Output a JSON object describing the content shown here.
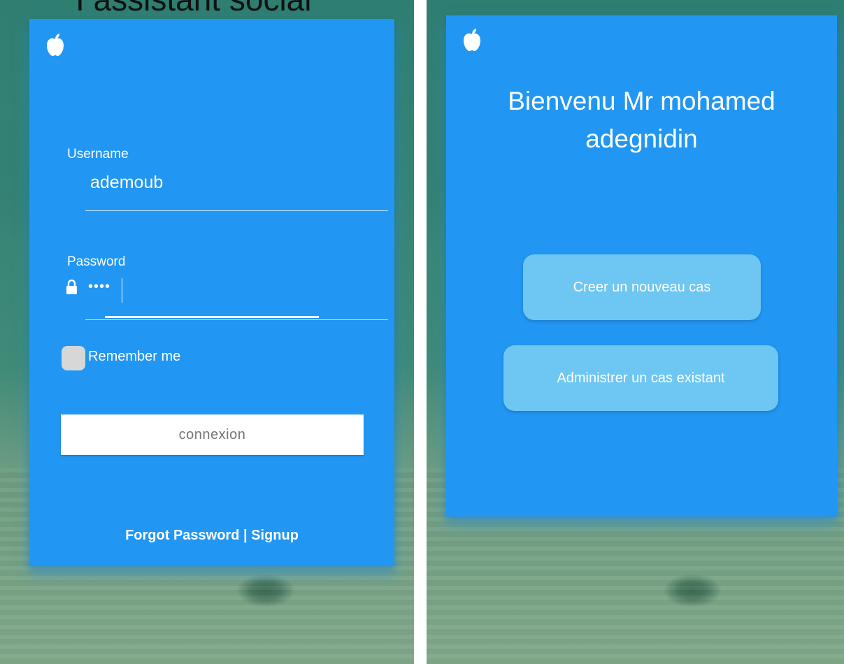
{
  "left_screen": {
    "overlay_text": "I assistant social",
    "login": {
      "username_label": "Username",
      "username_value": "ademoub",
      "password_label": "Password",
      "password_value": "••••",
      "remember_label": "Remember me",
      "connect_label": "connexion",
      "forgot_label": "Forgot Password",
      "separator": " | ",
      "signup_label": "Signup"
    }
  },
  "right_screen": {
    "welcome": {
      "title_line1": "Bienvenu Mr mohamed",
      "title_line2": "adegnidin",
      "create_label": "Creer un nouveau cas",
      "admin_label": "Administrer un cas existant"
    }
  },
  "colors": {
    "card": "#2196f3",
    "button_pill": "#6ec6f2",
    "background_teal": "#2f7e72"
  },
  "icons": [
    "apple-icon",
    "lock-icon"
  ]
}
